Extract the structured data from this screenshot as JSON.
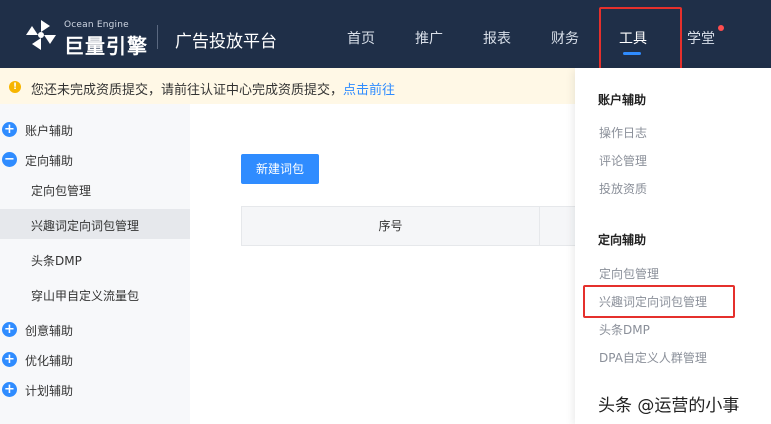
{
  "header": {
    "brand_en": "Ocean Engine",
    "brand_cn": "巨量引擎",
    "platform": "广告投放平台",
    "nav": [
      {
        "label": "首页"
      },
      {
        "label": "推广"
      },
      {
        "label": "报表"
      },
      {
        "label": "财务"
      },
      {
        "label": "工具",
        "active": true
      },
      {
        "label": "学堂",
        "badge_dot": true
      }
    ]
  },
  "notice": {
    "text": "您还未完成资质提交，请前往认证中心完成资质提交，",
    "link": "点击前往"
  },
  "sidebar": {
    "items": [
      {
        "label": "账户辅助",
        "icon": "plus-circle-icon"
      },
      {
        "label": "定向辅助",
        "icon": "minus-circle-icon"
      },
      {
        "label": "定向包管理"
      },
      {
        "label": "兴趣词定向词包管理",
        "selected": true
      },
      {
        "label": "头条DMP"
      },
      {
        "label": "穿山甲自定义流量包"
      },
      {
        "label": "创意辅助",
        "icon": "plus-circle-icon"
      },
      {
        "label": "优化辅助",
        "icon": "plus-circle-icon"
      },
      {
        "label": "计划辅助",
        "icon": "plus-circle-icon"
      }
    ]
  },
  "main": {
    "new_button": "新建词包",
    "table": {
      "columns": [
        "序号"
      ]
    }
  },
  "dropdown": {
    "groups": [
      {
        "title": "账户辅助",
        "items": [
          "操作日志",
          "评论管理",
          "投放资质"
        ]
      },
      {
        "title": "定向辅助",
        "items": [
          "定向包管理",
          "兴趣词定向词包管理",
          "头条DMP",
          "DPA自定义人群管理"
        ]
      }
    ]
  },
  "watermark": "头条 @运营的小事",
  "colors": {
    "topbar": "#1f2f48",
    "accent": "#2f8cff",
    "highlight": "#e5302c",
    "notice_bg": "#fff8e6"
  }
}
